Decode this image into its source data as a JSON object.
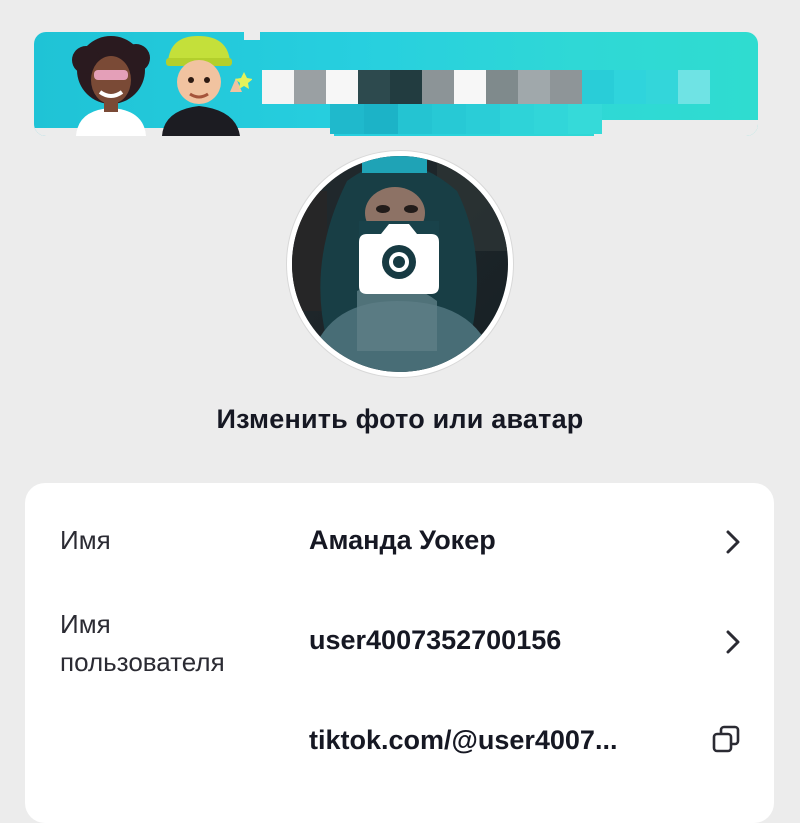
{
  "profile": {
    "change_photo_label": "Изменить фото или аватар"
  },
  "fields": {
    "name": {
      "label": "Имя",
      "value": "Аманда Уокер"
    },
    "username": {
      "label_line1": "Имя",
      "label_line2": "пользователя",
      "value": "user4007352700156"
    },
    "link": {
      "value": "tiktok.com/@user4007..."
    }
  },
  "icons": {
    "camera": "camera-icon",
    "chevron": "chevron-right-icon",
    "copy": "copy-icon"
  },
  "colors": {
    "background": "#ececec",
    "card": "#ffffff",
    "banner_teal": "#27cfdf",
    "text_primary": "#161823"
  }
}
